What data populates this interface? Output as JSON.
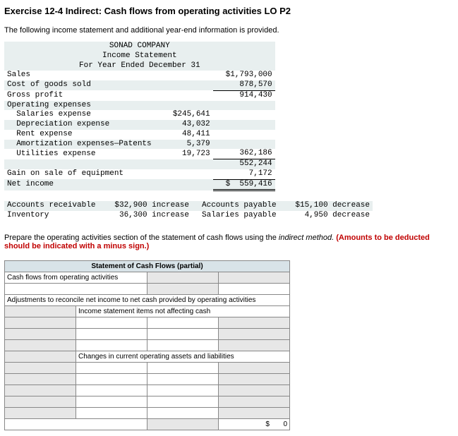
{
  "title": "Exercise 12-4 Indirect: Cash flows from operating activities LO P2",
  "intro": "The following income statement and additional year-end information is provided.",
  "income": {
    "company": "SONAD COMPANY",
    "report": "Income Statement",
    "period": "For Year Ended December 31",
    "rows": {
      "sales_label": "Sales",
      "sales_amt": "$1,793,000",
      "cogs_label": "Cost of goods sold",
      "cogs_amt": "878,570",
      "gp_label": "Gross profit",
      "gp_amt": "914,430",
      "opex_label": "Operating expenses",
      "sal_label": "  Salaries expense",
      "sal_amt": "$245,641",
      "dep_label": "  Depreciation expense",
      "dep_amt": "43,032",
      "rent_label": "  Rent expense",
      "rent_amt": "48,411",
      "amort_label": "  Amortization expenses—Patents",
      "amort_amt": "5,379",
      "util_label": "  Utilities expense",
      "util_amt": "19,723",
      "opex_total": "362,186",
      "opinc_amt": "552,244",
      "gain_label": "Gain on sale of equipment",
      "gain_amt": "7,172",
      "ni_label": "Net income",
      "ni_amt": "$  559,416"
    }
  },
  "changes": {
    "ar_label": "Accounts receivable",
    "ar_val": "$32,900 increase",
    "ap_label": "Accounts payable",
    "ap_val": "$15,100 decrease",
    "inv_label": "Inventory",
    "inv_val": "36,300 increase",
    "sp_label": "Salaries payable",
    "sp_val": "4,950 decrease"
  },
  "instruction": {
    "part1": "Prepare the operating activities section of the statement of cash flows using the ",
    "em": "indirect method.",
    "red": " (Amounts to be deducted should be indicated with a minus sign.)"
  },
  "worksheet": {
    "header": "Statement of Cash Flows (partial)",
    "r1": "Cash flows from operating activities",
    "r2": "Adjustments to reconcile net income to net cash provided by operating activities",
    "r3": "Income statement items not affecting cash",
    "r4": "Changes in current operating assets and liabilities",
    "dollar": "$",
    "zero": "0"
  }
}
